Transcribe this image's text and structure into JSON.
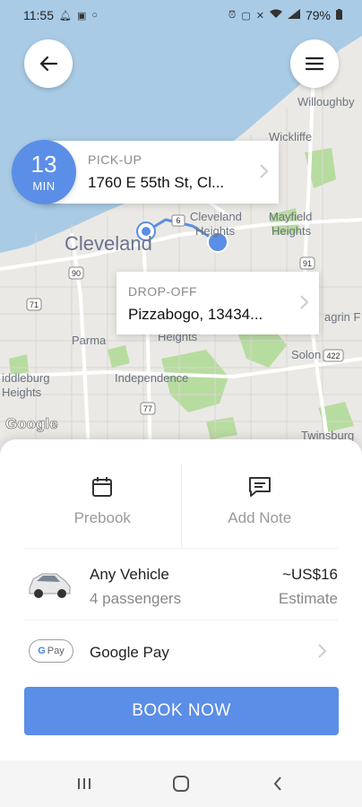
{
  "status_bar": {
    "time": "11:55",
    "battery": "79%",
    "left_icons": [
      "notification-bell-icon",
      "gallery-icon",
      "whatsapp-icon"
    ],
    "right_icons": [
      "alarm-icon",
      "nfc-icon",
      "mute-icon",
      "wifi-icon",
      "volte-icon",
      "signal-icon",
      "battery-icon"
    ]
  },
  "map": {
    "labels": {
      "willoughby": "Willoughby",
      "wickliffe": "Wickliffe",
      "cleveland_big": "Cleveland",
      "cleveland_heights_1": "Cleveland",
      "cleveland_heights_2": "Heights",
      "mayfield_1": "Mayfield",
      "mayfield_2": "Heights",
      "parma": "Parma",
      "heights": "Heights",
      "independence": "Independence",
      "middleburg_1": "iddleburg",
      "middleburg_2": "Heights",
      "solon": "Solon",
      "twinsburg": "Twinsburg",
      "chagrin": "agrin F",
      "road_6": "6",
      "road_90": "90",
      "road_71": "71",
      "road_91": "91",
      "road_77": "77",
      "road_422": "422",
      "attribution": "Google"
    }
  },
  "eta": {
    "value": "13",
    "unit": "MIN"
  },
  "pickup": {
    "label": "PICK-UP",
    "address": "1760 E 55th St, Cl..."
  },
  "dropoff": {
    "label": "DROP-OFF",
    "address": "Pizzabogo, 13434..."
  },
  "options": {
    "prebook": "Prebook",
    "add_note": "Add Note"
  },
  "vehicle": {
    "name": "Any Vehicle",
    "passengers": "4 passengers",
    "price": "~US$16",
    "price_note": "Estimate"
  },
  "payment": {
    "badge_g": "G",
    "badge_pay": "Pay",
    "label": "Google Pay"
  },
  "book_button": "BOOK NOW",
  "colors": {
    "accent": "#5b8ee6",
    "water": "#a9cbe6",
    "park": "#b7dca0"
  }
}
